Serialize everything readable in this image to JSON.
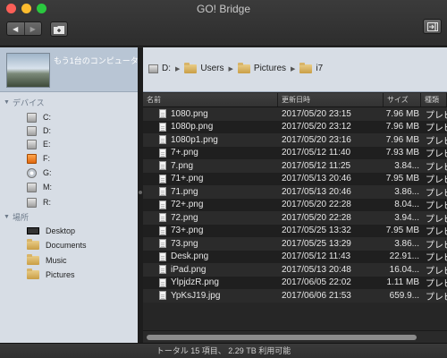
{
  "window": {
    "title": "GO! Bridge"
  },
  "sidebar": {
    "computer_label": "もう1台のコンピュータ",
    "devices_header": "デバイス",
    "devices": [
      {
        "label": "C:",
        "icon": "drive-icon"
      },
      {
        "label": "D:",
        "icon": "drive-icon"
      },
      {
        "label": "E:",
        "icon": "drive-icon"
      },
      {
        "label": "F:",
        "icon": "orange-drive-icon"
      },
      {
        "label": "G:",
        "icon": "disc-icon"
      },
      {
        "label": "M:",
        "icon": "drive-icon"
      },
      {
        "label": "R:",
        "icon": "drive-icon"
      }
    ],
    "places_header": "場所",
    "places": [
      {
        "label": "Desktop",
        "icon": "desktop-icon"
      },
      {
        "label": "Documents",
        "icon": "folder-icon"
      },
      {
        "label": "Music",
        "icon": "folder-icon"
      },
      {
        "label": "Pictures",
        "icon": "folder-icon"
      }
    ]
  },
  "path": [
    "D:",
    "Users",
    "Pictures",
    "i7"
  ],
  "columns": {
    "name": "名前",
    "date": "更新日時",
    "size": "サイズ",
    "kind": "種類"
  },
  "files": [
    {
      "name": "1080.png",
      "date": "2017/05/20 23:15",
      "size": "7.96 MB",
      "kind": "プレビ"
    },
    {
      "name": "1080p.png",
      "date": "2017/05/20 23:12",
      "size": "7.96 MB",
      "kind": "プレビ"
    },
    {
      "name": "1080p1.png",
      "date": "2017/05/20 23:16",
      "size": "7.96 MB",
      "kind": "プレビ"
    },
    {
      "name": "7+.png",
      "date": "2017/05/12 11:40",
      "size": "7.93 MB",
      "kind": "プレビ"
    },
    {
      "name": "7.png",
      "date": "2017/05/12 11:25",
      "size": "3.84...",
      "kind": "プレビ"
    },
    {
      "name": "71+.png",
      "date": "2017/05/13 20:46",
      "size": "7.95 MB",
      "kind": "プレビ"
    },
    {
      "name": "71.png",
      "date": "2017/05/13 20:46",
      "size": "3.86...",
      "kind": "プレビ"
    },
    {
      "name": "72+.png",
      "date": "2017/05/20 22:28",
      "size": "8.04...",
      "kind": "プレビ"
    },
    {
      "name": "72.png",
      "date": "2017/05/20 22:28",
      "size": "3.94...",
      "kind": "プレビ"
    },
    {
      "name": "73+.png",
      "date": "2017/05/25 13:32",
      "size": "7.95 MB",
      "kind": "プレビ"
    },
    {
      "name": "73.png",
      "date": "2017/05/25 13:29",
      "size": "3.86...",
      "kind": "プレビ"
    },
    {
      "name": "Desk.png",
      "date": "2017/05/12 11:43",
      "size": "22.91...",
      "kind": "プレビ"
    },
    {
      "name": "iPad.png",
      "date": "2017/05/13 20:48",
      "size": "16.04...",
      "kind": "プレビ"
    },
    {
      "name": "YlpjdzR.png",
      "date": "2017/06/05 22:02",
      "size": "1.11 MB",
      "kind": "プレビ"
    },
    {
      "name": "YpKsJ19.jpg",
      "date": "2017/06/06 21:53",
      "size": "659.9...",
      "kind": "プレビ"
    }
  ],
  "status": "トータル 15 項目、 2.29 TB 利用可能"
}
